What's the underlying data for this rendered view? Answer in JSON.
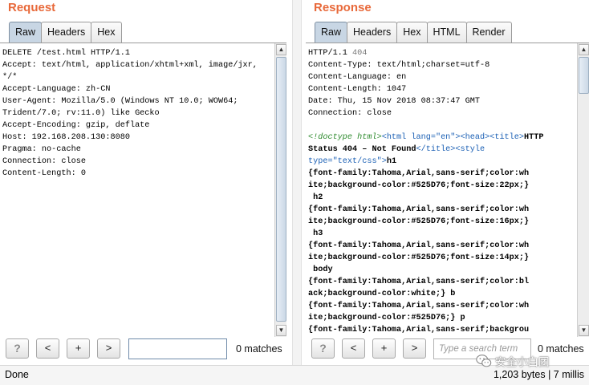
{
  "request": {
    "title": "Request",
    "tabs": [
      "Raw",
      "Headers",
      "Hex"
    ],
    "active_tab": "Raw",
    "lines": [
      "DELETE /test.html HTTP/1.1",
      "Accept: text/html, application/xhtml+xml, image/jxr,",
      "*/*",
      "Accept-Language: zh-CN",
      "User-Agent: Mozilla/5.0 (Windows NT 10.0; WOW64;",
      "Trident/7.0; rv:11.0) like Gecko",
      "Accept-Encoding: gzip, deflate",
      "Host: 192.168.208.130:8080",
      "Pragma: no-cache",
      "Connection: close",
      "Content-Length: 0"
    ],
    "search": {
      "help": "?",
      "prev": "<",
      "add": "+",
      "next": ">",
      "value": "",
      "placeholder": "",
      "matches": "0 matches"
    }
  },
  "response": {
    "title": "Response",
    "tabs": [
      "Raw",
      "Headers",
      "Hex",
      "HTML",
      "Render"
    ],
    "active_tab": "Raw",
    "headers": {
      "status_line": "HTTP/1.1",
      "status_code": "404",
      "content_type": "Content-Type: text/html;charset=utf-8",
      "content_language": "Content-Language: en",
      "content_length": "Content-Length: 1047",
      "date": "Date: Thu, 15 Nov 2018 08:37:47 GMT",
      "connection": "Connection: close"
    },
    "body": {
      "doctype": "<!doctype html>",
      "html_open": "<html lang=\"en\">",
      "head_open": "<head>",
      "title_open": "<title>",
      "title_text_1": "HTTP",
      "title_text_2": "Status 404 – Not Found",
      "title_close": "</title>",
      "style_open_tag": "<style",
      "style_type": "type=\"text/css\">",
      "css_lines": [
        "h1",
        "{font-family:Tahoma,Arial,sans-serif;color:wh",
        "ite;background-color:#525D76;font-size:22px;}",
        " h2",
        "{font-family:Tahoma,Arial,sans-serif;color:wh",
        "ite;background-color:#525D76;font-size:16px;}",
        " h3",
        "{font-family:Tahoma,Arial,sans-serif;color:wh",
        "ite;background-color:#525D76;font-size:14px;}",
        " body",
        "{font-family:Tahoma,Arial,sans-serif;color:bl",
        "ack;background-color:white;} b",
        "{font-family:Tahoma,Arial,sans-serif;color:wh",
        "ite;background-color:#525D76;} p",
        "{font-family:Tahoma,Arial,sans-serif;backgrou"
      ]
    },
    "search": {
      "help": "?",
      "prev": "<",
      "add": "+",
      "next": ">",
      "value": "",
      "placeholder": "Type a search term",
      "matches": "0 matches"
    }
  },
  "status_bar": {
    "left": "Done",
    "right": "1,203 bytes | 7 millis"
  },
  "watermark": {
    "text": "安全小白团",
    "icon": "wechat-icon"
  }
}
